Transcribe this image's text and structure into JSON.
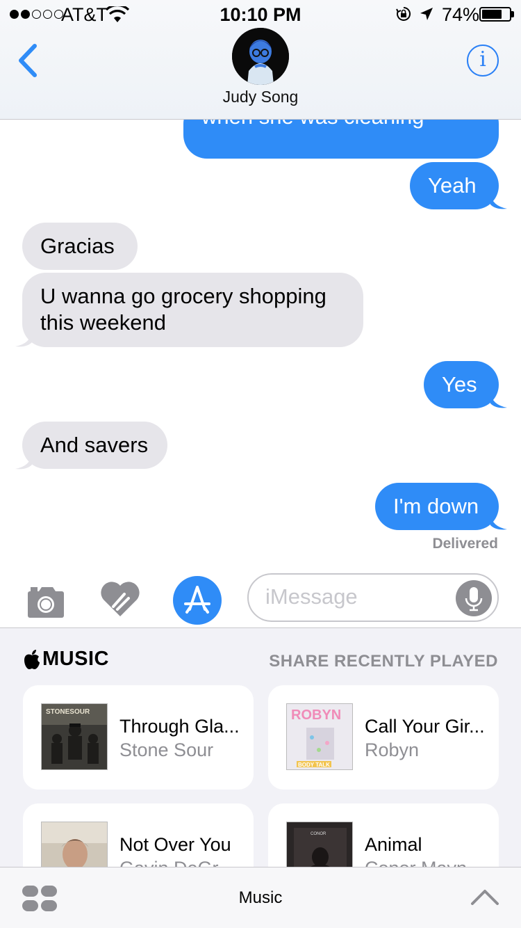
{
  "status_bar": {
    "carrier": "AT&T",
    "time": "10:10 PM",
    "battery_percent": "74%",
    "battery_level": 0.74,
    "signal_bars": 2
  },
  "nav": {
    "contact_name": "Judy Song",
    "info_label": "i",
    "accent_color": "#2f8cf7"
  },
  "messages": [
    {
      "direction": "outgoing",
      "text": "when she was cleaning"
    },
    {
      "direction": "outgoing",
      "text": "Yeah"
    },
    {
      "direction": "incoming",
      "text": "Gracias"
    },
    {
      "direction": "incoming",
      "text": "U wanna go grocery shopping this weekend"
    },
    {
      "direction": "outgoing",
      "text": "Yes"
    },
    {
      "direction": "incoming",
      "text": "And savers"
    },
    {
      "direction": "outgoing",
      "text": "I'm down"
    }
  ],
  "delivered_label": "Delivered",
  "input": {
    "placeholder": "iMessage",
    "icons": [
      "camera-icon",
      "digital-touch-heart-icon",
      "app-store-icon",
      "microphone-icon"
    ]
  },
  "music_drawer": {
    "brand_label": "MUSIC",
    "share_label": "SHARE RECENTLY PLAYED",
    "songs": [
      {
        "title": "Through Gla...",
        "artist": "Stone Sour"
      },
      {
        "title": "Call Your Gir...",
        "artist": "Robyn"
      },
      {
        "title": "Not Over You",
        "artist": "Gavin DeGr..."
      },
      {
        "title": "Animal",
        "artist": "Conor Mayn..."
      }
    ]
  },
  "bottom_bar": {
    "title": "Music"
  }
}
